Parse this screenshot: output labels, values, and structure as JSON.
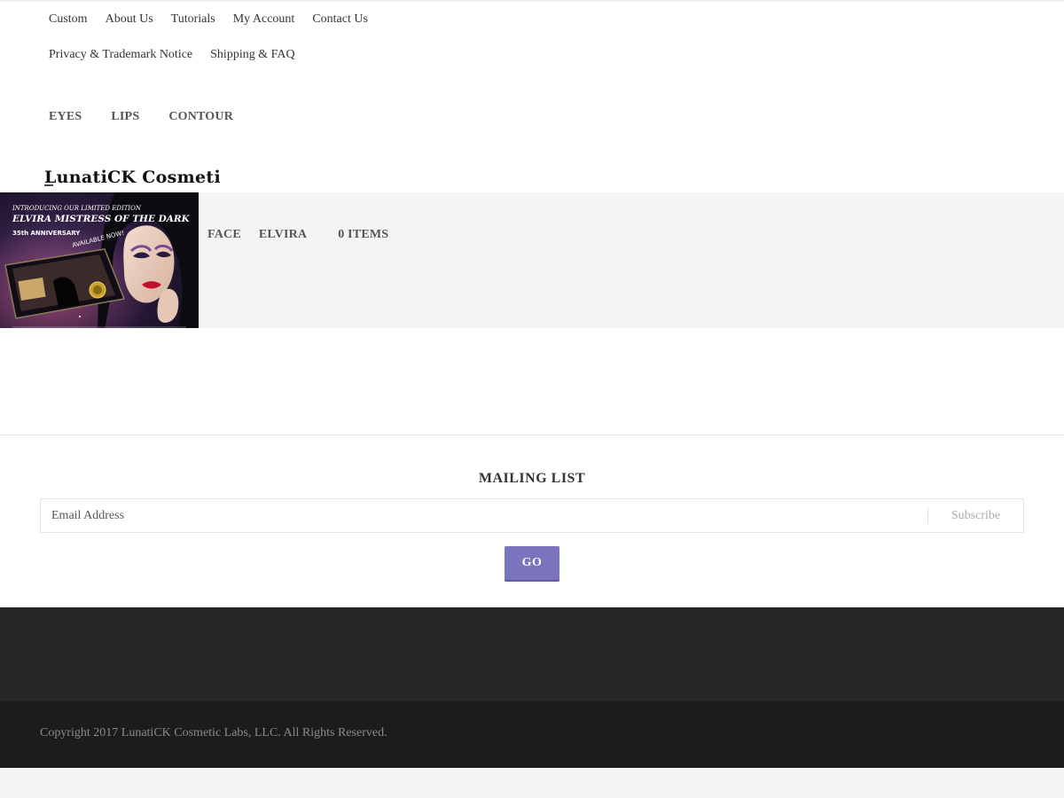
{
  "top_links": {
    "row1": [
      "Custom",
      "About Us",
      "Tutorials",
      "My Account",
      "Contact Us"
    ],
    "row2": [
      "Privacy & Trademark Notice",
      "Shipping & FAQ"
    ]
  },
  "category_nav": [
    "EYES",
    "LIPS",
    "CONTOUR"
  ],
  "logo": {
    "text": "LunatiCK Cosmetic Labs"
  },
  "promo_banner": {
    "line1": "INTRODUCING OUR LIMITED EDITION",
    "line2": "ELVIRA MISTRESS OF THE DARK",
    "line3": "35th ANNIVERSARY",
    "badge": "AVAILABLE NOW!"
  },
  "banner_nav": {
    "face": "FACE",
    "elvira": "ELVIRA",
    "cart": "0 ITEMS"
  },
  "mailing_list": {
    "title": "MAILING LIST",
    "email_placeholder": "Email Address",
    "subscribe_label": "Subscribe",
    "go_label": "GO"
  },
  "footer": {
    "copyright": "Copyright 2017 LunatiCK Cosmetic Labs, LLC. All Rights Reserved."
  },
  "colors": {
    "accent": "#7a74bd",
    "footer_top": "#262628",
    "footer_bottom": "#1c1c1c",
    "band": "#f4f4f4"
  }
}
